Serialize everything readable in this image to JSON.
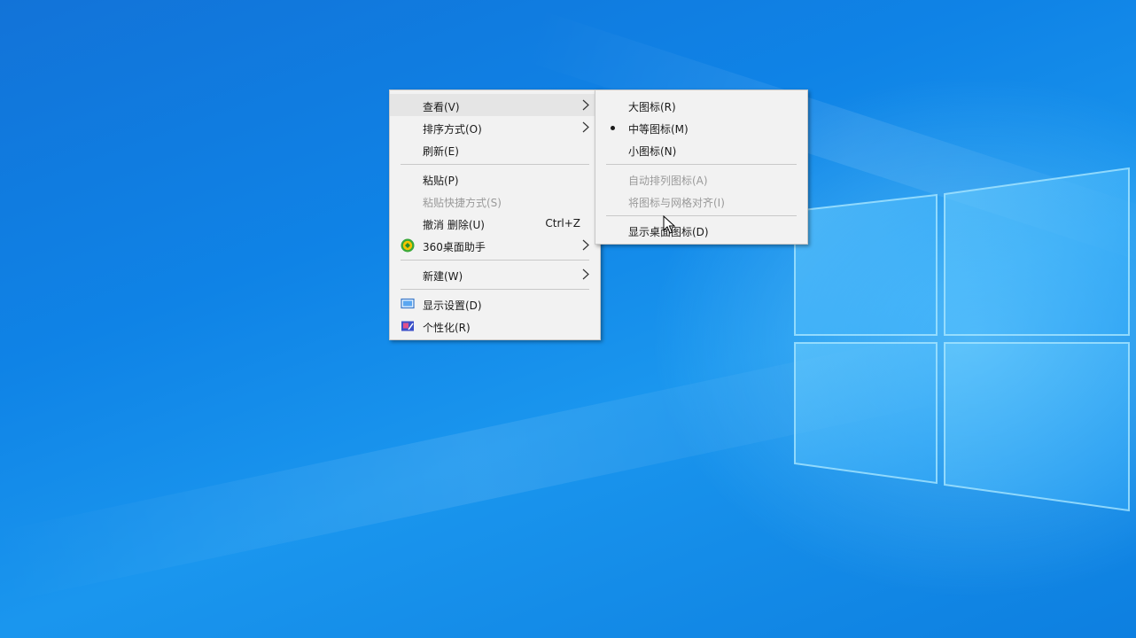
{
  "desktop": {
    "accent": "#1280e0"
  },
  "context_menu": {
    "items": [
      {
        "label": "查看(V)",
        "has_submenu": true
      },
      {
        "label": "排序方式(O)",
        "has_submenu": true
      },
      {
        "label": "刷新(E)"
      },
      {
        "label": "粘贴(P)"
      },
      {
        "label": "粘贴快捷方式(S)",
        "disabled": true
      },
      {
        "label": "撤消 删除(U)",
        "shortcut": "Ctrl+Z"
      },
      {
        "label": "360桌面助手",
        "has_submenu": true,
        "icon": "360-desktop-assistant-icon"
      },
      {
        "label": "新建(W)",
        "has_submenu": true
      },
      {
        "label": "显示设置(D)",
        "icon": "display-settings-icon"
      },
      {
        "label": "个性化(R)",
        "icon": "personalize-icon"
      }
    ]
  },
  "view_submenu": {
    "items": [
      {
        "label": "大图标(R)"
      },
      {
        "label": "中等图标(M)",
        "selected": true
      },
      {
        "label": "小图标(N)"
      },
      {
        "label": "自动排列图标(A)",
        "disabled": true
      },
      {
        "label": "将图标与网格对齐(I)",
        "disabled": true
      },
      {
        "label": "显示桌面图标(D)"
      }
    ]
  }
}
